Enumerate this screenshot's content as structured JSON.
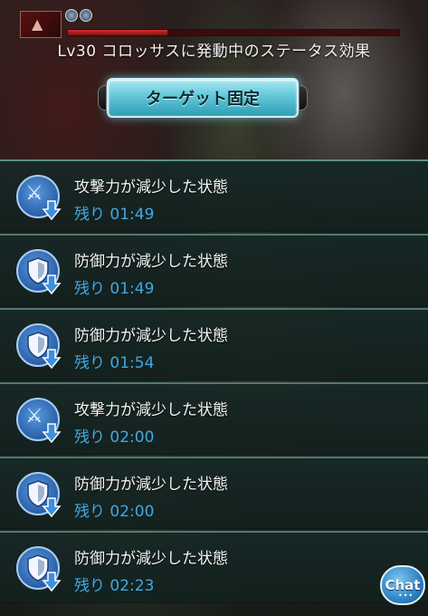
{
  "panel": {
    "title": "Lv30 コロッサスに発動中のステータス効果",
    "target_button": "ターゲット固定"
  },
  "boss": {
    "hp_fraction": 0.3
  },
  "statuses": [
    {
      "name": "攻撃力が減少した状態",
      "time": "残り 01:49",
      "icon": "attack-down-icon"
    },
    {
      "name": "防御力が減少した状態",
      "time": "残り 01:49",
      "icon": "defense-down-icon"
    },
    {
      "name": "防御力が減少した状態",
      "time": "残り 01:54",
      "icon": "defense-down-icon"
    },
    {
      "name": "攻撃力が減少した状態",
      "time": "残り 02:00",
      "icon": "attack-down-icon"
    },
    {
      "name": "防御力が減少した状態",
      "time": "残り 02:00",
      "icon": "defense-down-icon"
    },
    {
      "name": "防御力が減少した状態",
      "time": "残り 02:23",
      "icon": "defense-down-icon"
    }
  ],
  "chat": {
    "label": "Chat"
  },
  "colors": {
    "time_text": "#41a8e0",
    "row_bg": "#16282a",
    "target_button": "#62c7d8"
  }
}
